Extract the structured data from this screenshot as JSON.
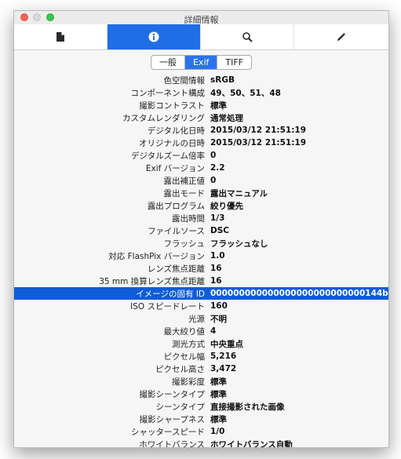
{
  "window": {
    "title": "詳細情報"
  },
  "toolbar": {
    "tabs": [
      {
        "icon": "document-icon",
        "active": false
      },
      {
        "icon": "info-icon",
        "active": true
      },
      {
        "icon": "search-icon",
        "active": false
      },
      {
        "icon": "pencil-icon",
        "active": false
      }
    ],
    "accent": "#1f6ee6"
  },
  "segments": [
    {
      "label": "一般",
      "active": false
    },
    {
      "label": "Exif",
      "active": true
    },
    {
      "label": "TIFF",
      "active": false
    }
  ],
  "rows": [
    {
      "label": "色空間情報",
      "value": "sRGB"
    },
    {
      "label": "コンポーネント構成",
      "value": "49、50、51、48"
    },
    {
      "label": "撮影コントラスト",
      "value": "標準"
    },
    {
      "label": "カスタムレンダリング",
      "value": "通常処理"
    },
    {
      "label": "デジタル化日時",
      "value": "2015/03/12 21:51:19"
    },
    {
      "label": "オリジナルの日時",
      "value": "2015/03/12 21:51:19"
    },
    {
      "label": "デジタルズーム倍率",
      "value": "0"
    },
    {
      "label": "Exif バージョン",
      "value": "2.2"
    },
    {
      "label": "露出補正値",
      "value": "0"
    },
    {
      "label": "露出モード",
      "value": "露出マニュアル"
    },
    {
      "label": "露出プログラム",
      "value": "絞り優先"
    },
    {
      "label": "露出時間",
      "value": "1/3"
    },
    {
      "label": "ファイルソース",
      "value": "DSC"
    },
    {
      "label": "フラッシュ",
      "value": "フラッシュなし"
    },
    {
      "label": "対応 FlashPix バージョン",
      "value": "1.0"
    },
    {
      "label": "レンズ焦点距離",
      "value": "16"
    },
    {
      "label": "35 mm 換算レンズ焦点距離",
      "value": "16"
    },
    {
      "label": "イメージの固有 ID",
      "value": "000000000000000000000000000144b",
      "selected": true
    },
    {
      "label": "ISO スピードレート",
      "value": "160"
    },
    {
      "label": "光源",
      "value": "不明"
    },
    {
      "label": "最大絞り値",
      "value": "4"
    },
    {
      "label": "測光方式",
      "value": "中央重点"
    },
    {
      "label": "ピクセル幅",
      "value": "5,216"
    },
    {
      "label": "ピクセル高さ",
      "value": "3,472"
    },
    {
      "label": "撮影彩度",
      "value": "標準"
    },
    {
      "label": "撮影シーンタイプ",
      "value": "標準"
    },
    {
      "label": "シーンタイプ",
      "value": "直接撮影された画像"
    },
    {
      "label": "撮影シャープネス",
      "value": "標準"
    },
    {
      "label": "シャッタースピード",
      "value": "1/0"
    },
    {
      "label": "ホワイトバランス",
      "value": "ホワイトバランス自動"
    }
  ]
}
